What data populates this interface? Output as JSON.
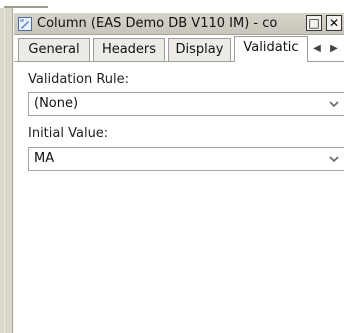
{
  "window": {
    "title": "Column (EAS Demo DB V110 IM) - co",
    "maximize_glyph": "□",
    "close_glyph": "✕"
  },
  "tabs": [
    {
      "label": "General"
    },
    {
      "label": "Headers"
    },
    {
      "label": "Display"
    },
    {
      "label": "Validatic"
    }
  ],
  "tab_scroll": {
    "left": "◀",
    "right": "▶"
  },
  "form": {
    "validation_rule": {
      "label": "Validation Rule:",
      "value": "(None)"
    },
    "initial_value": {
      "label": "Initial Value:",
      "value": "MA"
    }
  }
}
